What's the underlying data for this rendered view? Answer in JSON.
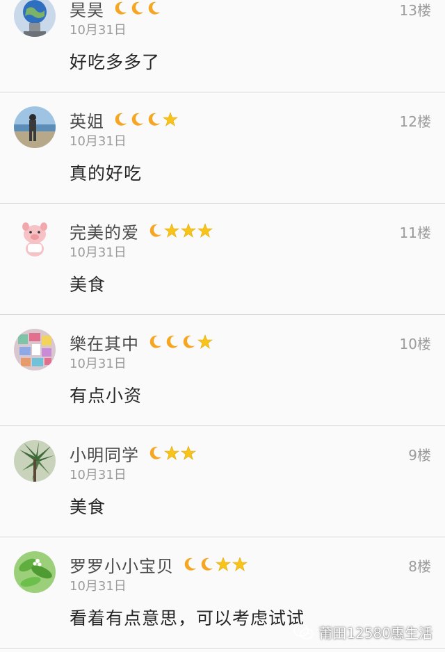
{
  "comments": [
    {
      "name": "昊昊",
      "date": "10月31日",
      "floor": "13楼",
      "text": "好吃多多了",
      "level_icons": [
        "moon-icon",
        "moon-icon",
        "moon-icon"
      ],
      "avatar": "globe-statue"
    },
    {
      "name": "英姐",
      "date": "10月31日",
      "floor": "12楼",
      "text": "真的好吃",
      "level_icons": [
        "moon-icon",
        "moon-icon",
        "moon-icon",
        "star-icon"
      ],
      "avatar": "person-at-beach"
    },
    {
      "name": "完美的爱",
      "date": "10月31日",
      "floor": "11楼",
      "text": "美食",
      "level_icons": [
        "moon-icon",
        "star-icon",
        "star-icon",
        "star-icon"
      ],
      "avatar": "cartoon-pig"
    },
    {
      "name": "樂在其中",
      "date": "10月31日",
      "floor": "10楼",
      "text": "有点小资",
      "level_icons": [
        "moon-icon",
        "moon-icon",
        "moon-icon",
        "star-icon"
      ],
      "avatar": "colorful-collage"
    },
    {
      "name": "小明同学",
      "date": "10月31日",
      "floor": "9楼",
      "text": "美食",
      "level_icons": [
        "moon-icon",
        "star-icon",
        "star-icon"
      ],
      "avatar": "palm-tree"
    },
    {
      "name": "罗罗小小宝贝",
      "date": "10月31日",
      "floor": "8楼",
      "text": "看着有点意思，可以考虑试试",
      "level_icons": [
        "moon-icon",
        "moon-icon",
        "star-icon",
        "star-icon"
      ],
      "avatar": "green-leaves"
    }
  ],
  "watermark": {
    "text": "莆田12580惠生活",
    "icon": "wechat-icon"
  },
  "colors": {
    "background": "#fafafa",
    "divider": "#d8d8d8",
    "nickname": "#4a4a4a",
    "meta": "#9b9b9b",
    "body_text": "#262626",
    "moon": "#f5a623",
    "star": "#f8c41b"
  }
}
